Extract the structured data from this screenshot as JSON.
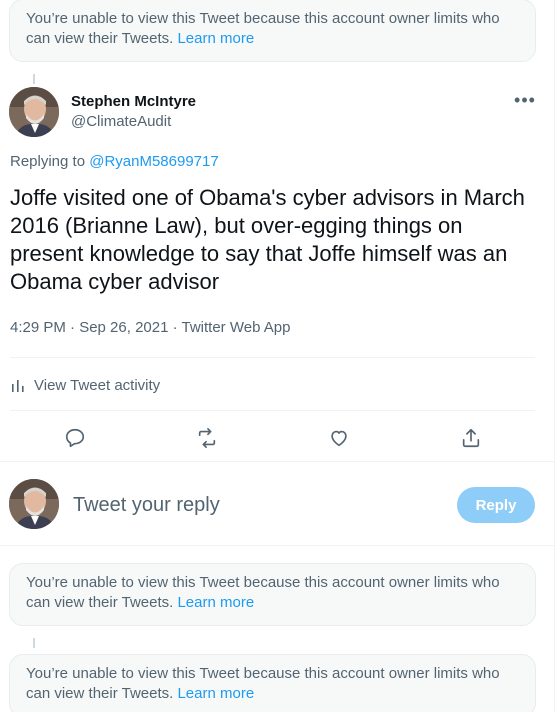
{
  "notices": [
    {
      "text": "You’re unable to view this Tweet because this account owner limits who can view their Tweets.",
      "link": "Learn more"
    },
    {
      "text": "You’re unable to view this Tweet because this account owner limits who can view their Tweets.",
      "link": "Learn more"
    },
    {
      "text": "You’re unable to view this Tweet because this account owner limits who can view their Tweets.",
      "link": "Learn more"
    }
  ],
  "tweet": {
    "author_name": "Stephen McIntyre",
    "author_handle": "@ClimateAudit",
    "more_icon": "more-horizontal-icon",
    "replying_prefix": "Replying to",
    "replying_handle": "@RyanM58699717",
    "text": "Joffe visited one of Obama's cyber advisors in March 2016 (Brianne Law), but over-egging things on present knowledge to say that Joffe himself was an Obama cyber advisor",
    "timestamp": "4:29 PM · Sep 26, 2021 · Twitter Web App",
    "activity_label": "View Tweet activity"
  },
  "actions": [
    {
      "name": "reply-icon"
    },
    {
      "name": "retweet-icon"
    },
    {
      "name": "like-icon"
    },
    {
      "name": "share-icon"
    }
  ],
  "compose": {
    "placeholder": "Tweet your reply",
    "reply_button": "Reply"
  },
  "colors": {
    "accent": "#1d9bf0",
    "reply_button_disabled": "#8ecdf8",
    "secondary_text": "#536471",
    "notice_bg": "#f7f9f9"
  }
}
